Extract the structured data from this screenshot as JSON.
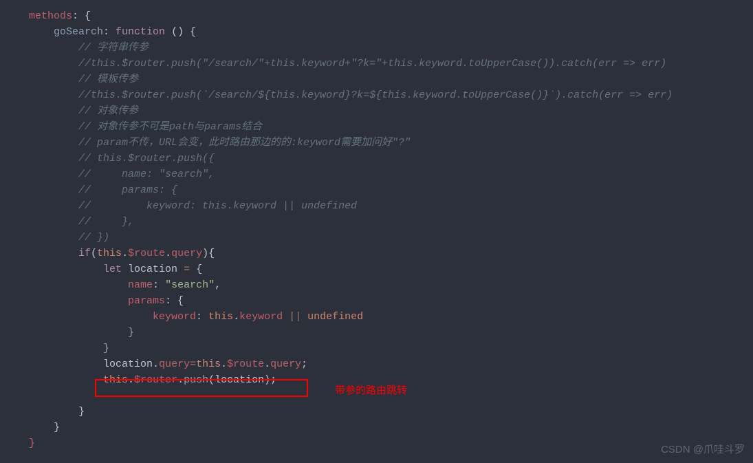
{
  "code": {
    "l1_methods": "methods",
    "l1_colon": ": {",
    "l2_goSearch": "goSearch",
    "l2_colon": ": ",
    "l2_function": "function",
    "l2_parens": " () {",
    "c1": "// 字符串传参",
    "c2": "//this.$router.push(\"/search/\"+this.keyword+\"?k=\"+this.keyword.toUpperCase()).catch(err => err)",
    "c3": "// 模板传参",
    "c4": "//this.$router.push(`/search/${this.keyword}?k=${this.keyword.toUpperCase()}`).catch(err => err)",
    "c5": "// 对象传参",
    "c6": "// 对象传参不可是path与params结合",
    "c7": "// param不传，URL会变，此时路由那边的的:keyword需要加问好\"?\"",
    "c8": "// this.$router.push({",
    "c9": "//     name: \"search\",",
    "c10": "//     params: {",
    "c11": "//         keyword: this.keyword || undefined",
    "c12": "//     },",
    "c13": "// })",
    "if_kw": "if",
    "if_open": "(",
    "if_this": "this",
    "if_dot1": ".",
    "if_route": "$route",
    "if_dot2": ".",
    "if_query": "query",
    "if_close": "){",
    "let_kw": "let",
    "let_var": " location ",
    "let_eq": "=",
    "let_brace": " {",
    "name_key": "name",
    "name_colon": ": ",
    "name_val": "\"search\"",
    "name_comma": ",",
    "params_key": "params",
    "params_colon": ": {",
    "keyword_key": "keyword",
    "keyword_colon": ": ",
    "keyword_this": "this",
    "keyword_dot": ".",
    "keyword_prop": "keyword",
    "keyword_or": " || ",
    "keyword_undef": "undefined",
    "close_brace1": "}",
    "close_brace2": "}",
    "loc_var": "location",
    "loc_dot1": ".",
    "loc_query": "query",
    "loc_eq": "=",
    "loc_this": "this",
    "loc_dot2": ".",
    "loc_route": "$route",
    "loc_dot3": ".",
    "loc_query2": "query",
    "loc_semi": ";",
    "push_this": "this",
    "push_dot1": ".",
    "push_router": "$router",
    "push_dot2": ".",
    "push_method": "push",
    "push_open": "(",
    "push_arg": "location",
    "push_close": ");",
    "close_if": "}",
    "close_fn": "}",
    "close_methods": "}"
  },
  "annotation": "带参的路由跳转",
  "watermark": "CSDN @爪哇斗罗"
}
